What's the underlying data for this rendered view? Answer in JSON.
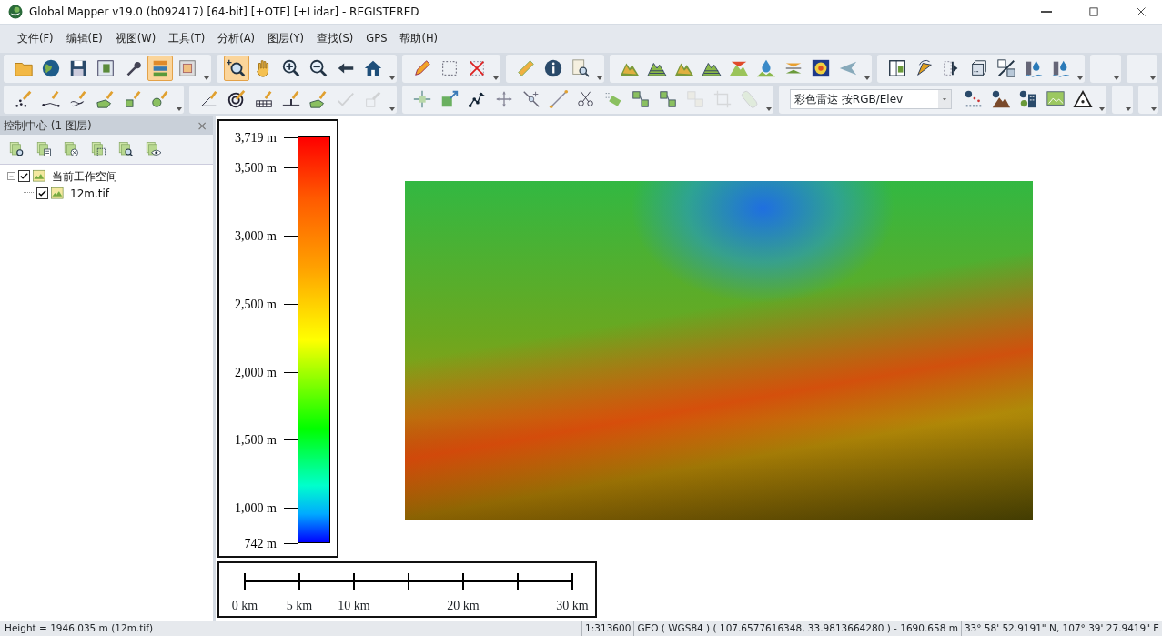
{
  "window": {
    "title": "Global Mapper v19.0 (b092417) [64-bit] [+OTF] [+Lidar] - REGISTERED"
  },
  "menu": [
    "文件(F)",
    "编辑(E)",
    "视图(W)",
    "工具(T)",
    "分析(A)",
    "图层(Y)",
    "查找(S)",
    "GPS",
    "帮助(H)"
  ],
  "toolbar_rows": [
    [
      {
        "buttons": [
          {
            "selected": false,
            "disabled": false
          },
          {
            "selected": false,
            "disabled": false
          },
          {
            "selected": false,
            "disabled": false
          },
          {
            "selected": false,
            "disabled": false
          },
          {
            "selected": false,
            "disabled": false
          },
          {
            "selected": true,
            "disabled": false
          },
          {
            "selected": false,
            "disabled": false
          }
        ]
      },
      {
        "buttons": [
          {
            "selected": true,
            "disabled": false
          },
          {
            "selected": false,
            "disabled": false
          },
          {
            "selected": false,
            "disabled": false
          },
          {
            "selected": false,
            "disabled": false
          },
          {
            "selected": false,
            "disabled": false
          },
          {
            "selected": false,
            "disabled": false
          }
        ]
      },
      {
        "buttons": [
          {
            "selected": false,
            "disabled": false
          },
          {
            "selected": false,
            "disabled": false
          },
          {
            "selected": false,
            "disabled": false
          }
        ]
      },
      {
        "buttons": [
          {
            "selected": false,
            "disabled": false
          },
          {
            "selected": false,
            "disabled": false
          },
          {
            "selected": false,
            "disabled": false
          }
        ]
      },
      {
        "buttons": [
          {
            "selected": false,
            "disabled": false
          },
          {
            "selected": false,
            "disabled": false
          },
          {
            "selected": false,
            "disabled": false
          },
          {
            "selected": false,
            "disabled": false
          },
          {
            "selected": false,
            "disabled": false
          },
          {
            "selected": false,
            "disabled": false
          },
          {
            "selected": false,
            "disabled": false
          },
          {
            "selected": false,
            "disabled": false
          },
          {
            "selected": false,
            "disabled": false
          }
        ]
      },
      {
        "buttons": [
          {
            "selected": false,
            "disabled": false
          },
          {
            "selected": false,
            "disabled": false
          },
          {
            "selected": false,
            "disabled": false
          },
          {
            "selected": false,
            "disabled": false
          },
          {
            "selected": false,
            "disabled": false
          },
          {
            "selected": false,
            "disabled": false
          },
          {
            "selected": false,
            "disabled": false
          }
        ]
      }
    ],
    [
      {
        "buttons": [
          {
            "selected": false,
            "disabled": false
          },
          {
            "selected": false,
            "disabled": false
          },
          {
            "selected": false,
            "disabled": false
          },
          {
            "selected": false,
            "disabled": false
          },
          {
            "selected": false,
            "disabled": false
          },
          {
            "selected": false,
            "disabled": false
          }
        ]
      },
      {
        "buttons": [
          {
            "selected": false,
            "disabled": false
          },
          {
            "selected": false,
            "disabled": false
          },
          {
            "selected": false,
            "disabled": false
          },
          {
            "selected": false,
            "disabled": false
          },
          {
            "selected": false,
            "disabled": false
          },
          {
            "selected": false,
            "disabled": true
          },
          {
            "selected": false,
            "disabled": true
          }
        ]
      },
      {
        "buttons": [
          {
            "selected": false,
            "disabled": false
          },
          {
            "selected": false,
            "disabled": false
          },
          {
            "selected": false,
            "disabled": false
          },
          {
            "selected": false,
            "disabled": false
          },
          {
            "selected": false,
            "disabled": false
          },
          {
            "selected": false,
            "disabled": false
          },
          {
            "selected": false,
            "disabled": false
          },
          {
            "selected": false,
            "disabled": false
          },
          {
            "selected": false,
            "disabled": false
          },
          {
            "selected": false,
            "disabled": false
          },
          {
            "selected": false,
            "disabled": true
          },
          {
            "selected": false,
            "disabled": true
          },
          {
            "selected": false,
            "disabled": true
          }
        ]
      },
      {
        "shader": "彩色雷达 按RGB/Elev",
        "buttons": [
          {
            "selected": false,
            "disabled": false
          },
          {
            "selected": false,
            "disabled": false
          },
          {
            "selected": false,
            "disabled": false
          },
          {
            "selected": false,
            "disabled": false
          },
          {
            "selected": false,
            "disabled": false
          }
        ]
      }
    ]
  ],
  "control_center": {
    "title": "控制中心 (1 图层)",
    "close": "×",
    "tree": [
      {
        "label": "当前工作空间",
        "checked": true,
        "expanded": true,
        "children": [
          {
            "label": "12m.tif",
            "checked": true
          }
        ]
      }
    ]
  },
  "legend": {
    "labels": [
      "3,719 m",
      "3,500 m",
      "3,000 m",
      "2,500 m",
      "2,000 m",
      "1,500 m",
      "1,000 m",
      "742 m"
    ]
  },
  "scale_bar": {
    "labels": [
      "0 km",
      "5 km",
      "10 km",
      "20 km",
      "30 km"
    ]
  },
  "status_bar": [
    "Height = 1946.035 m (12m.tif)",
    "1:313600",
    "GEO ( WGS84 ) ( 107.6577616348, 33.9813664280 ) - 1690.658 m",
    "33° 58' 52.9191\" N, 107° 39' 27.9419\" E"
  ]
}
